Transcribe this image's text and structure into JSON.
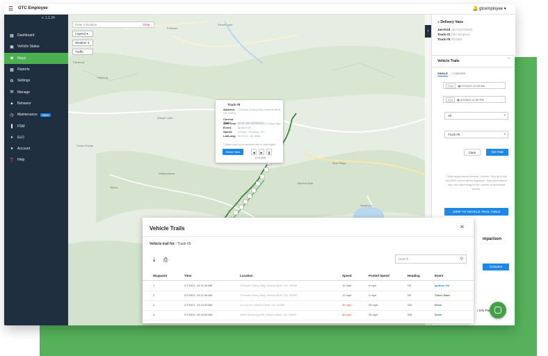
{
  "app": {
    "brand": "GTC Employee",
    "user": "gtcemployee",
    "version": "v. 1.1.24"
  },
  "sidebar": {
    "items": [
      {
        "label": "Dashboard",
        "icon": "dashboard-icon"
      },
      {
        "label": "Vehicle Status",
        "icon": "vehicle-icon"
      },
      {
        "label": "Maps",
        "icon": "map-pin-icon",
        "active": true
      },
      {
        "label": "Reports",
        "icon": "bar-chart-icon"
      },
      {
        "label": "Settings",
        "icon": "gear-icon"
      },
      {
        "label": "Manage",
        "icon": "wrench-icon"
      },
      {
        "label": "Behavior",
        "icon": "person-icon"
      },
      {
        "label": "Maintenance",
        "icon": "clock-icon",
        "badge": "NEW"
      },
      {
        "label": "FSM",
        "icon": "fsm-icon"
      },
      {
        "label": "ELD",
        "icon": "eld-icon"
      },
      {
        "label": "Account",
        "icon": "account-icon"
      },
      {
        "label": "Help",
        "icon": "help-icon"
      }
    ]
  },
  "map": {
    "search_placeholder": "Enter a location",
    "clear": "Clear",
    "legend": "Legend",
    "weather": "Weather",
    "traffic": "Traffic",
    "places": [
      "Fulltoner",
      "Faverock",
      "Hoyburg",
      "Wisper Lane",
      "Pierce Lane",
      "Willsboro",
      "Williamstown",
      "Tipton",
      "Crown Pointe",
      "Mineral Bluff",
      "Cherrylog",
      "Blue Ridge",
      "Reservoir"
    ]
  },
  "popup": {
    "title": "Truck #5",
    "rows": [
      {
        "label": "Address:",
        "value": "St Route Ewing Way, Mineral Bluff, GA 30559"
      },
      {
        "label": "Current Time:",
        "value": "02:00 PM 02/08/2021"
      },
      {
        "label": "Unit Time:",
        "value": "10:11 AM 02/07/2021 | 3 Days Ago"
      },
      {
        "label": "Event:",
        "value": "Ignition On"
      },
      {
        "label": "Speed:",
        "value": "12mph / Heading: SE"
      },
      {
        "label": "Lat/Long:",
        "value": "34.8740, -84.3588"
      }
    ],
    "note": "* Speed may not be accurate due to road engine",
    "street_view": "Street View",
    "counter": "(1 of 315)"
  },
  "right_panel": {
    "header": "Delivery Vans",
    "lines": [
      {
        "label": "Jan-Krid",
        "value": "Jan Krid Daniel"
      },
      {
        "label": "Truck #2",
        "value": "Dan Simpson"
      },
      {
        "label": "Truck #5",
        "value": "RD4982"
      }
    ],
    "section": "Vehicle Trails",
    "tab_single": "SINGLE",
    "tab_compare": "COMPARE",
    "start_label": "Start",
    "start_value": "2/7/2021 12:00 AM",
    "end_label": "End",
    "end_value": "2/9/2021 11:59 PM",
    "filter_value": "All",
    "vehicle_value": "Truck #5",
    "clear": "Clear",
    "get_trail": "Get Trail",
    "info": "* Date range cannot exceed 1 Month. Only up to the first 5000 events will be displayed. Map performance may vary depending on the number of processed events.",
    "jump": "JUMP TO VEHICLE TRAIL TABLE",
    "comparison": "mparison",
    "compare_btn": "Compare",
    "info_panel": "r Info Pan"
  },
  "modal": {
    "title": "Vehicle Trails",
    "subtitle_label": "Vehicle trail for :",
    "subtitle_value": "Truck #5",
    "search_placeholder": "Search",
    "columns": [
      "Waypoint",
      "Time",
      "Location",
      "Speed",
      "Posted Speed",
      "Heading",
      "Event"
    ],
    "rows": [
      {
        "waypoint": "1",
        "time": "2/7/2021, 10:11:49 AM",
        "location": "St Route Ewing Way, Mineral Bluff, GA, 30559",
        "speed": "12 mph",
        "speed_red": false,
        "posted": "0 mph",
        "heading": "SE",
        "event": "Ignition On",
        "event_blue": true
      },
      {
        "waypoint": "2",
        "time": "2/7/2021, 10:11:49 AM",
        "location": "St Route Ewing Way, Mineral Bluff, GA, 30559",
        "speed": "12 mph",
        "speed_red": false,
        "posted": "0 mph",
        "heading": "SE",
        "event": "Travel Start",
        "event_blue": false
      },
      {
        "waypoint": "3",
        "time": "2/7/2021, 10:13:49 AM",
        "location": "111 Ivy Rd, Mineral Bluff, GA, 30559",
        "speed": "35 mph",
        "speed_red": true,
        "posted": "35 mph",
        "heading": "SW",
        "event": "Drive",
        "event_blue": false
      },
      {
        "waypoint": "4",
        "time": "2/7/2021, 10:15:49 AM",
        "location": "4800 Ventucopa Rd, Mineral Bluff, GA, 30559",
        "speed": "40 mph",
        "speed_red": true,
        "posted": "35 mph",
        "heading": "SW",
        "event": "Drive",
        "event_blue": false
      }
    ]
  },
  "colors": {
    "accent": "#4caf50",
    "sidebar": "#1f2f3f",
    "primary": "#1e88e5",
    "backdrop": "#55b25b"
  }
}
